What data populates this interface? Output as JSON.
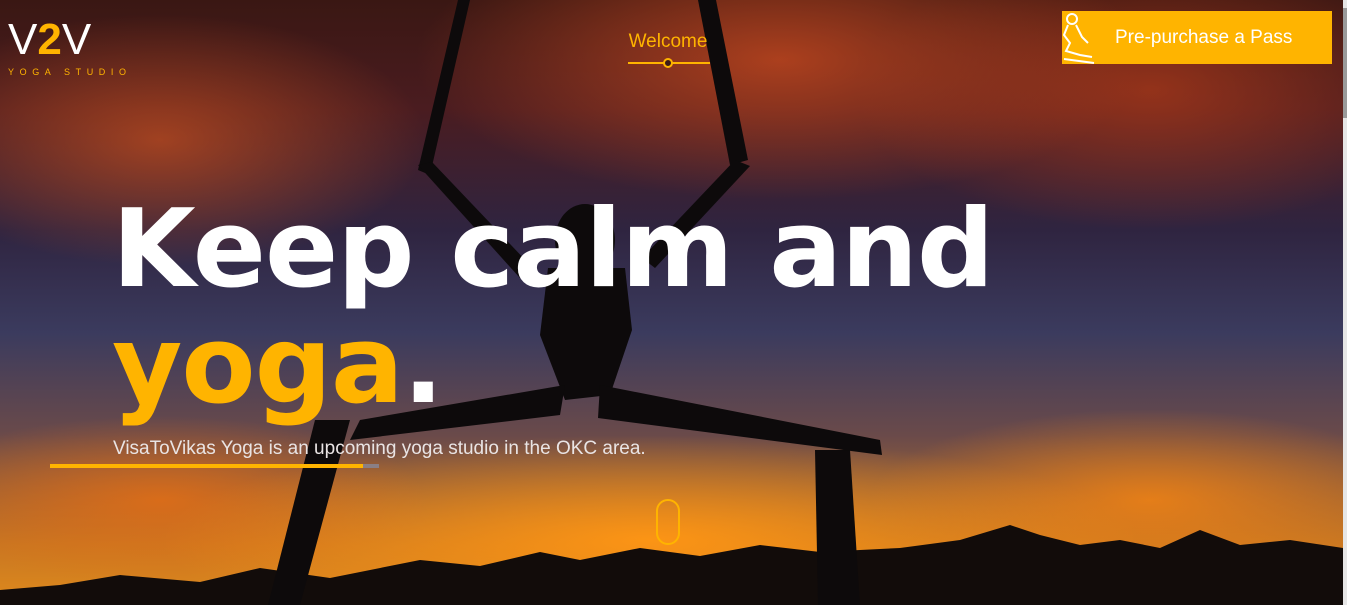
{
  "header": {
    "logo": {
      "mark_left": "V",
      "mark_accent": "2",
      "mark_right": "V",
      "subtitle": "YOGA STUDIO"
    },
    "nav": {
      "welcome_label": "Welcome"
    },
    "cta": {
      "label": "Pre-purchase a Pass",
      "icon": "meditation-figure-icon"
    }
  },
  "hero": {
    "headline_line1": "Keep calm and",
    "headline_accent": "yoga",
    "headline_end": ".",
    "tagline": "VisaToVikas Yoga is an upcoming yoga studio in the OKC area.",
    "slide_progress": 0.95,
    "scroll_icon": "mouse-scroll-icon"
  },
  "colors": {
    "accent": "#ffb400",
    "text_light": "#ffffff"
  }
}
